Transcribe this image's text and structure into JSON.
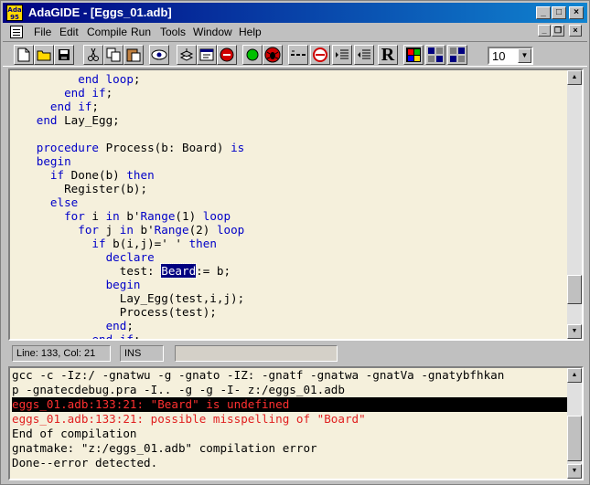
{
  "window": {
    "app_icon_text": [
      "Ada",
      "95"
    ],
    "title": "AdaGIDE - [Eggs_01.adb]"
  },
  "menu": [
    "File",
    "Edit",
    "Compile",
    "Run",
    "Tools",
    "Window",
    "Help"
  ],
  "toolbar": {
    "icons": [
      "new-file-icon",
      "open-folder-icon",
      "save-icon",
      "cut-icon",
      "copy-icon",
      "paste-icon",
      "view-eye-icon",
      "compile-stack-icon",
      "debug-icon",
      "stop-icon",
      "run-green-icon",
      "run-bug-icon",
      "step-icon",
      "clock-icon",
      "indent-icon",
      "outdent-icon",
      "reformat-icon",
      "windows-flag-icon",
      "translate-icon"
    ],
    "reformat_label": "R",
    "font_size": "10"
  },
  "editor": {
    "lines": [
      [
        [
          "         ",
          ""
        ],
        [
          "end loop",
          "kw"
        ],
        [
          ";",
          ""
        ]
      ],
      [
        [
          "       ",
          ""
        ],
        [
          "end if",
          "kw"
        ],
        [
          ";",
          ""
        ]
      ],
      [
        [
          "     ",
          ""
        ],
        [
          "end if",
          "kw"
        ],
        [
          ";",
          ""
        ]
      ],
      [
        [
          "   ",
          ""
        ],
        [
          "end",
          "kw"
        ],
        [
          " Lay_Egg;",
          ""
        ]
      ],
      [
        [
          "",
          ""
        ]
      ],
      [
        [
          "   ",
          ""
        ],
        [
          "procedure",
          "kw"
        ],
        [
          " Process(b: Board) ",
          ""
        ],
        [
          "is",
          "kw"
        ]
      ],
      [
        [
          "   ",
          ""
        ],
        [
          "begin",
          "kw"
        ]
      ],
      [
        [
          "     ",
          ""
        ],
        [
          "if",
          "kw"
        ],
        [
          " Done(b) ",
          ""
        ],
        [
          "then",
          "kw"
        ]
      ],
      [
        [
          "       Register(b);",
          ""
        ]
      ],
      [
        [
          "     ",
          ""
        ],
        [
          "else",
          "kw"
        ]
      ],
      [
        [
          "       ",
          ""
        ],
        [
          "for",
          "kw"
        ],
        [
          " i ",
          ""
        ],
        [
          "in",
          "kw"
        ],
        [
          " b'",
          ""
        ],
        [
          "Range",
          "kw"
        ],
        [
          "(1) ",
          ""
        ],
        [
          "loop",
          "kw"
        ]
      ],
      [
        [
          "         ",
          ""
        ],
        [
          "for",
          "kw"
        ],
        [
          " j ",
          ""
        ],
        [
          "in",
          "kw"
        ],
        [
          " b'",
          ""
        ],
        [
          "Range",
          "kw"
        ],
        [
          "(2) ",
          ""
        ],
        [
          "loop",
          "kw"
        ]
      ],
      [
        [
          "           ",
          ""
        ],
        [
          "if",
          "kw"
        ],
        [
          " b(i,j)=' ' ",
          ""
        ],
        [
          "then",
          "kw"
        ]
      ],
      [
        [
          "             ",
          ""
        ],
        [
          "declare",
          "kw"
        ]
      ],
      [
        [
          "               test: ",
          ""
        ],
        [
          "Beard",
          "sel"
        ],
        [
          ":= b;",
          ""
        ]
      ],
      [
        [
          "             ",
          ""
        ],
        [
          "begin",
          "kw"
        ]
      ],
      [
        [
          "               Lay_Egg(test,i,j);",
          ""
        ]
      ],
      [
        [
          "               Process(test);",
          ""
        ]
      ],
      [
        [
          "             ",
          ""
        ],
        [
          "end",
          "kw"
        ],
        [
          ";",
          ""
        ]
      ],
      [
        [
          "           ",
          ""
        ],
        [
          "end if",
          "kw"
        ],
        [
          ";",
          ""
        ]
      ]
    ]
  },
  "status": {
    "position": "Line: 133, Col: 21",
    "mode": "INS"
  },
  "output": {
    "lines": [
      {
        "text": "gcc -c -Iz:/ -gnatwu -g -gnato -IZ: -gnatf -gnatwa -gnatVa -gnatybfhkan",
        "kind": "normal"
      },
      {
        "text": "p -gnatecdebug.pra -I.. -g -g -I- z:/eggs_01.adb",
        "kind": "normal"
      },
      {
        "text": "eggs_01.adb:133:21: \"Beard\" is undefined",
        "kind": "error-selected"
      },
      {
        "text": "eggs_01.adb:133:21: possible misspelling of \"Board\"",
        "kind": "error"
      },
      {
        "text": "End of compilation",
        "kind": "normal"
      },
      {
        "text": "gnatmake: \"z:/eggs_01.adb\" compilation error",
        "kind": "normal"
      },
      {
        "text": "Done--error detected.",
        "kind": "normal"
      }
    ]
  }
}
